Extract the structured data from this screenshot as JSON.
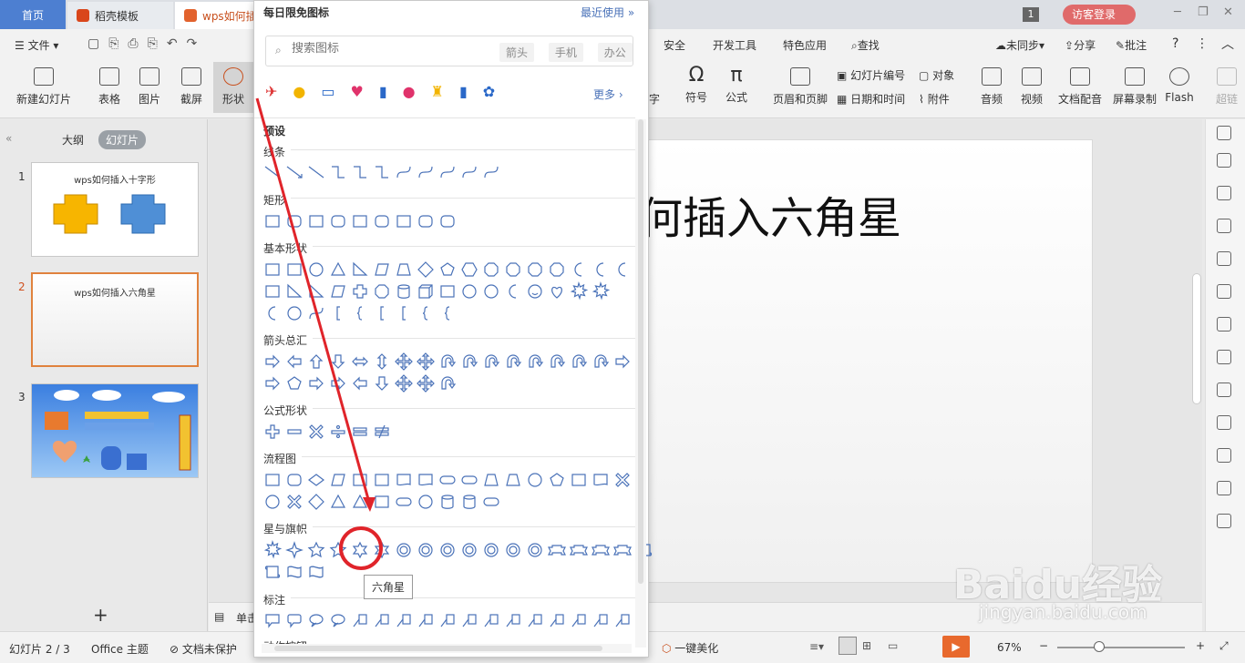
{
  "tabs": {
    "home": "首页",
    "template": "稻壳模板",
    "doc": "wps如何插"
  },
  "window": {
    "badge": "1",
    "login": "访客登录"
  },
  "menu": {
    "file": "文件",
    "security": "安全",
    "devtools": "开发工具",
    "features": "特色应用",
    "find": "查找",
    "sync": "未同步",
    "share": "分享",
    "comment": "批注"
  },
  "toolbar": {
    "new_slide": "新建幻灯片",
    "table": "表格",
    "picture": "图片",
    "screenshot": "截屏",
    "shape": "形状",
    "text": "字",
    "symbol": "符号",
    "formula": "公式",
    "header_footer": "页眉和页脚",
    "slide_number": "幻灯片编号",
    "object": "对象",
    "datetime": "日期和时间",
    "attachment": "附件",
    "audio": "音频",
    "video": "视频",
    "doc_voice": "文档配音",
    "screen_record": "屏幕录制",
    "flash": "Flash",
    "super": "超链"
  },
  "panel": {
    "outline_tab": "大纲",
    "slides_tab": "幻灯片"
  },
  "slides": [
    {
      "num": "1",
      "title": "wps如何插入十字形"
    },
    {
      "num": "2",
      "title": "wps如何插入六角星"
    },
    {
      "num": "3",
      "title": ""
    }
  ],
  "main_slide_title": "何插入六角星",
  "notes_label": "单击",
  "status": {
    "slide_pos": "幻灯片 2 / 3",
    "theme": "Office 主题",
    "protect": "文档未保护",
    "beautify": "一键美化",
    "zoom": "67%"
  },
  "popup": {
    "title": "每日限免图标",
    "recent": "最近使用",
    "search_placeholder": "搜索图标",
    "chips": [
      "箭头",
      "手机",
      "办公"
    ],
    "more": "更多",
    "preset": "预设",
    "sections": [
      "线条",
      "矩形",
      "基本形状",
      "箭头总汇",
      "公式形状",
      "流程图",
      "星与旗帜",
      "标注",
      "动作按钮"
    ],
    "tooltip": "六角星"
  },
  "watermark": {
    "brand": "Baidu经验",
    "url": "jingyan.baidu.com"
  },
  "colors": {
    "accent": "#4d7fd1",
    "annotation": "#e0242a",
    "shape_stroke": "#4a72b8",
    "wps_orange": "#c8501e"
  }
}
